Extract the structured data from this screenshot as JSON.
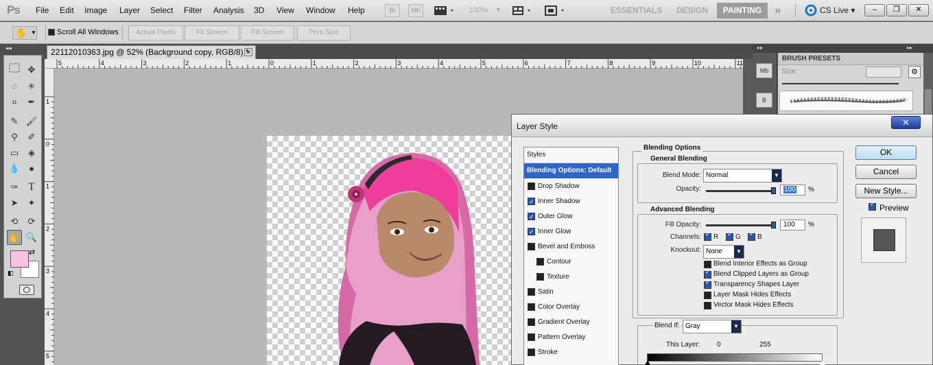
{
  "app": {
    "logo": "Ps",
    "menus": [
      "File",
      "Edit",
      "Image",
      "Layer",
      "Select",
      "Filter",
      "Analysis",
      "3D",
      "View",
      "Window",
      "Help"
    ],
    "toolbar_buttons": [
      "Br",
      "Mb"
    ],
    "zoom": "100%",
    "workspaces": [
      "ESSENTIALS",
      "DESIGN",
      "PAINTING"
    ],
    "active_workspace": "PAINTING",
    "more_glyph": "»",
    "cs_live": "CS Live",
    "accent_color": "#2f64c8"
  },
  "options_bar": {
    "scroll_all_windows": "Scroll All Windows",
    "buttons": [
      "Actual Pixels",
      "Fit Screen",
      "Fill Screen",
      "Print Size"
    ]
  },
  "document": {
    "tab_title": "22112010363.jpg @ 52% (Background copy, RGB/8) *",
    "ruler_h": [
      "5",
      "4",
      "3",
      "2",
      "1",
      "0",
      "1",
      "2",
      "3",
      "4",
      "5",
      "6",
      "7",
      "8",
      "9",
      "10",
      "11"
    ],
    "ruler_v": [
      "1",
      "0",
      "1",
      "2",
      "3",
      "4",
      "5"
    ]
  },
  "colors": {
    "foreground": "#f9c2e2",
    "background": "#ffffff"
  },
  "brush_presets": {
    "title": "BRUSH PRESETS",
    "size_label": "Size:"
  },
  "mini_panels": [
    "Mb",
    "B"
  ],
  "layer_style": {
    "title": "Layer Style",
    "close": "✕",
    "styles_header": "Styles",
    "items": [
      {
        "label": "Blending Options: Default",
        "selected": true
      },
      {
        "label": "Drop Shadow",
        "checked": false
      },
      {
        "label": "Inner Shadow",
        "checked": true
      },
      {
        "label": "Outer Glow",
        "checked": true
      },
      {
        "label": "Inner Glow",
        "checked": true
      },
      {
        "label": "Bevel and Emboss",
        "checked": false
      },
      {
        "label": "Contour",
        "checked": false,
        "sub": true
      },
      {
        "label": "Texture",
        "checked": false,
        "sub": true
      },
      {
        "label": "Satin",
        "checked": false
      },
      {
        "label": "Color Overlay",
        "checked": false
      },
      {
        "label": "Gradient Overlay",
        "checked": false
      },
      {
        "label": "Pattern Overlay",
        "checked": false
      },
      {
        "label": "Stroke",
        "checked": false
      }
    ],
    "blending_options_title": "Blending Options",
    "general_blending": {
      "title": "General Blending",
      "blend_mode_label": "Blend Mode:",
      "blend_mode": "Normal",
      "opacity_label": "Opacity:",
      "opacity": "100",
      "unit": "%"
    },
    "advanced_blending": {
      "title": "Advanced Blending",
      "fill_opacity_label": "Fill Opacity:",
      "fill_opacity": "100",
      "unit": "%",
      "channels_label": "Channels:",
      "channels": [
        "R",
        "G",
        "B"
      ],
      "knockout_label": "Knockout:",
      "knockout": "None",
      "options": [
        {
          "label": "Blend Interior Effects as Group",
          "checked": false
        },
        {
          "label": "Blend Clipped Layers as Group",
          "checked": true
        },
        {
          "label": "Transparency Shapes Layer",
          "checked": true
        },
        {
          "label": "Layer Mask Hides Effects",
          "checked": false
        },
        {
          "label": "Vector Mask Hides Effects",
          "checked": false
        }
      ]
    },
    "blend_if": {
      "label": "Blend If:",
      "value": "Gray",
      "this_layer_label": "This Layer:",
      "min": "0",
      "max": "255"
    },
    "buttons": {
      "ok": "OK",
      "cancel": "Cancel",
      "new_style": "New Style...",
      "preview": "Preview"
    }
  }
}
